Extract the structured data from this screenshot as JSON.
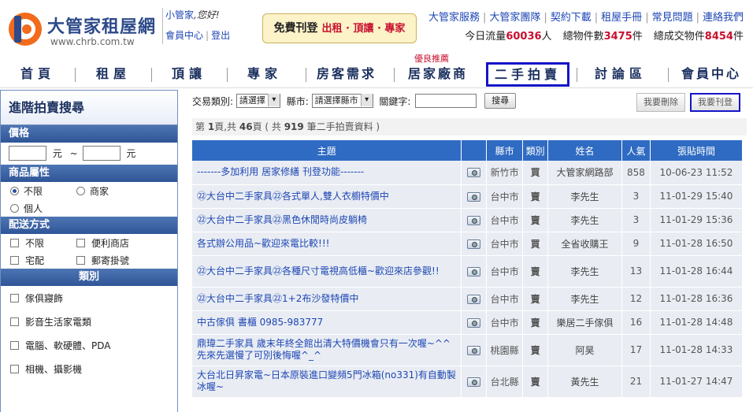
{
  "header": {
    "logo_title": "大管家租屋網",
    "logo_url": "www.chrb.com.tw",
    "user_name": "小管家",
    "user_greeting": ",您好!",
    "member_center": "會員中心",
    "logout": "登出",
    "promo_main": "免費刊登",
    "promo_sub": "出租 · 頂讓 · 專家",
    "top_links": [
      "大管家服務",
      "大管家團隊",
      "契約下載",
      "租屋手冊",
      "常見問題",
      "連絡我們"
    ],
    "stats": {
      "today_label": "今日流量",
      "today_value": "60036",
      "today_unit": "人",
      "total_label": "總物件數",
      "total_value": "3475",
      "total_unit": "件",
      "deals_label": "總成交物件",
      "deals_value": "8454",
      "deals_unit": "件"
    }
  },
  "nav": {
    "items": [
      "首頁",
      "租屋",
      "頂讓",
      "專家",
      "房客需求",
      "居家廠商",
      "二手拍賣",
      "討論區",
      "會員中心"
    ],
    "active": "二手拍賣",
    "badge": "優良推薦"
  },
  "sidebar": {
    "title": "進階拍賣搜尋",
    "price_head": "價格",
    "price_unit": "元",
    "price_tilde": "~",
    "attr_head": "商品屬性",
    "attr_options": [
      "不限",
      "商家",
      "個人"
    ],
    "attr_selected": "不限",
    "delivery_head": "配送方式",
    "delivery_options": [
      "不限",
      "便利商店",
      "宅配",
      "郵寄掛號"
    ],
    "category_head": "類別",
    "categories": [
      "傢俱寢飾",
      "影音生活家電類",
      "電腦、軟硬體、PDA",
      "相機、攝影機"
    ]
  },
  "filters": {
    "type_label": "交易類別:",
    "type_value": "請選擇",
    "city_label": "縣市:",
    "city_value": "請選擇縣市",
    "keyword_label": "關鍵字:",
    "keyword_value": "",
    "search_button": "搜尋",
    "delete_button": "我要刪除",
    "post_button": "我要刊登"
  },
  "pagination": {
    "prefix": "第",
    "page": "1",
    "mid": "頁,共",
    "pages": "46",
    "mid2": "頁 ( 共",
    "total": "919",
    "suffix": "筆二手拍賣資料 )"
  },
  "table": {
    "headers": [
      "主題",
      "",
      "縣市",
      "類別",
      "姓名",
      "人氣",
      "張貼時間"
    ],
    "rows": [
      {
        "subject": "-------多加利用 居家修繕 刊登功能-------",
        "city": "新竹市",
        "kind": "買",
        "name": "大管家網路部",
        "views": "858",
        "time": "10-06-23 11:52"
      },
      {
        "subject": "㉒大台中二手家具㉒各式單人,雙人衣櫥特價中",
        "city": "台中市",
        "kind": "賣",
        "name": "李先生",
        "views": "3",
        "time": "11-01-29 15:40"
      },
      {
        "subject": "㉒大台中二手家具㉒黑色休閒時尚皮躺椅",
        "city": "台中市",
        "kind": "賣",
        "name": "李先生",
        "views": "3",
        "time": "11-01-29 15:36"
      },
      {
        "subject": "各式辦公用品~歡迎來電比較!!!",
        "city": "台中市",
        "kind": "買",
        "name": "全省收購王",
        "views": "9",
        "time": "11-01-28 16:50"
      },
      {
        "subject": "㉒大台中二手家具㉒各種尺寸電視高低櫃~歡迎來店參觀!!",
        "city": "台中市",
        "kind": "賣",
        "name": "李先生",
        "views": "13",
        "time": "11-01-28 16:44"
      },
      {
        "subject": "㉒大台中二手家具㉒1+2布沙發特價中",
        "city": "台中市",
        "kind": "賣",
        "name": "李先生",
        "views": "12",
        "time": "11-01-28 16:36"
      },
      {
        "subject": "中古傢俱 書櫃 0985-983777",
        "city": "台中市",
        "kind": "賣",
        "name": "樂居二手傢俱",
        "views": "16",
        "time": "11-01-28 14:48"
      },
      {
        "subject": "鼎瑋二手家具 歲末年終全館出清大特價機會只有一次喔~^^先來先選慢了可別後悔喔^_^",
        "city": "桃園縣",
        "kind": "賣",
        "name": "阿昊",
        "views": "17",
        "time": "11-01-28 14:33"
      },
      {
        "subject": "大台北日昇家電~日本原裝進口變頻5門冰箱(no331)有自動製冰喔~",
        "city": "台北縣",
        "kind": "賣",
        "name": "黃先生",
        "views": "21",
        "time": "11-01-27 14:47"
      }
    ]
  },
  "icons": {
    "photo": "camera-icon",
    "logo": "house-logo-icon"
  },
  "colors": {
    "brand": "#2d4a8a",
    "accent_red": "#c8102e",
    "table_header": "#2f6bc2",
    "active_border": "#1414c8"
  }
}
